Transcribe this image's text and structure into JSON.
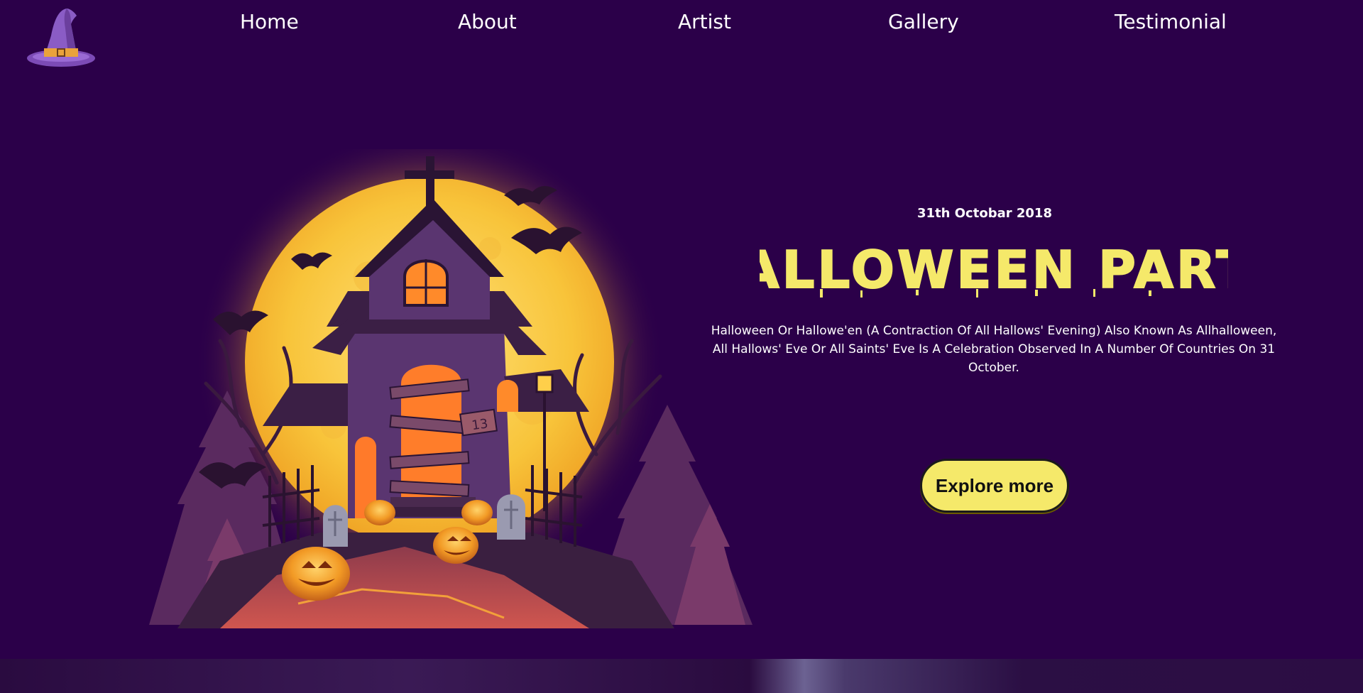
{
  "nav": {
    "links": [
      "Home",
      "About",
      "Artist",
      "Gallery",
      "Testimonial"
    ]
  },
  "hero": {
    "date": "31th Octobar 2018",
    "title": "HALLOWEEN PARTY",
    "description": "Halloween Or Hallowe'en (A Contraction Of All Hallows' Evening) Also Known As Allhalloween, All Hallows' Eve Or All Saints' Eve Is A Celebration Observed In A Number Of Countries On 31 October.",
    "cta_label": "Explore more",
    "house_number": "13"
  },
  "colors": {
    "background": "#2b0049",
    "accent_yellow": "#f5e96a",
    "moon": "#f7c43b"
  },
  "icons": {
    "logo": "witch-hat-icon"
  }
}
